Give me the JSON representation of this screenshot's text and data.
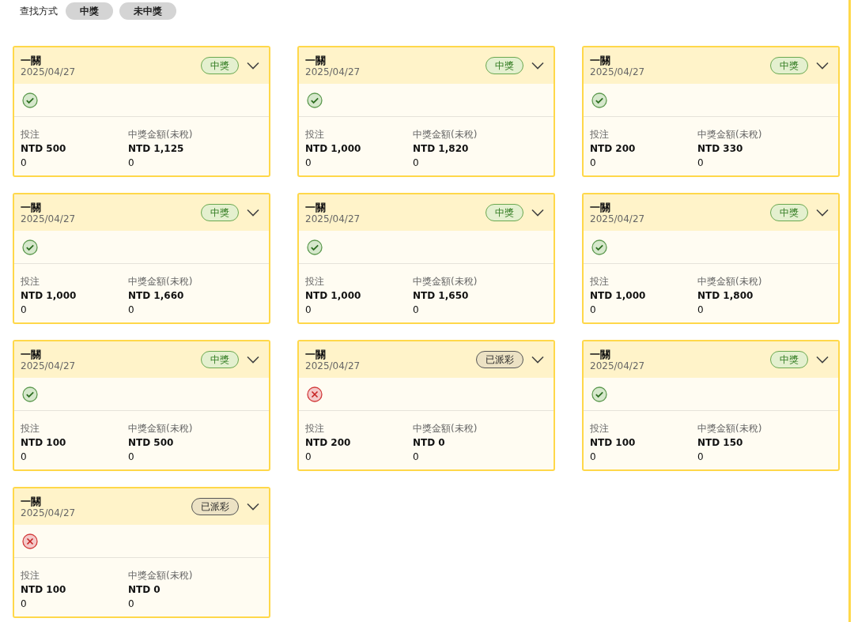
{
  "filter": {
    "label": "查找方式",
    "options": [
      "中獎",
      "未中獎"
    ]
  },
  "cards": [
    {
      "title": "一關",
      "date": "2025/04/27",
      "status": {
        "kind": "won",
        "label": "中獎"
      },
      "won": true,
      "stake_label": "投注",
      "stake": "NTD 500",
      "stake_extra": "0",
      "prize_label": "中獎金額(未稅)",
      "prize": "NTD 1,125",
      "prize_extra": "0"
    },
    {
      "title": "一關",
      "date": "2025/04/27",
      "status": {
        "kind": "won",
        "label": "中獎"
      },
      "won": true,
      "stake_label": "投注",
      "stake": "NTD 1,000",
      "stake_extra": "0",
      "prize_label": "中獎金額(未稅)",
      "prize": "NTD 1,820",
      "prize_extra": "0"
    },
    {
      "title": "一關",
      "date": "2025/04/27",
      "status": {
        "kind": "won",
        "label": "中獎"
      },
      "won": true,
      "stake_label": "投注",
      "stake": "NTD 200",
      "stake_extra": "0",
      "prize_label": "中獎金額(未稅)",
      "prize": "NTD 330",
      "prize_extra": "0"
    },
    {
      "title": "一關",
      "date": "2025/04/27",
      "status": {
        "kind": "won",
        "label": "中獎"
      },
      "won": true,
      "stake_label": "投注",
      "stake": "NTD 1,000",
      "stake_extra": "0",
      "prize_label": "中獎金額(未稅)",
      "prize": "NTD 1,660",
      "prize_extra": "0"
    },
    {
      "title": "一關",
      "date": "2025/04/27",
      "status": {
        "kind": "won",
        "label": "中獎"
      },
      "won": true,
      "stake_label": "投注",
      "stake": "NTD 1,000",
      "stake_extra": "0",
      "prize_label": "中獎金額(未稅)",
      "prize": "NTD 1,650",
      "prize_extra": "0"
    },
    {
      "title": "一關",
      "date": "2025/04/27",
      "status": {
        "kind": "won",
        "label": "中獎"
      },
      "won": true,
      "stake_label": "投注",
      "stake": "NTD 1,000",
      "stake_extra": "0",
      "prize_label": "中獎金額(未稅)",
      "prize": "NTD 1,800",
      "prize_extra": "0"
    },
    {
      "title": "一關",
      "date": "2025/04/27",
      "status": {
        "kind": "won",
        "label": "中獎"
      },
      "won": true,
      "stake_label": "投注",
      "stake": "NTD 100",
      "stake_extra": "0",
      "prize_label": "中獎金額(未稅)",
      "prize": "NTD 500",
      "prize_extra": "0"
    },
    {
      "title": "一關",
      "date": "2025/04/27",
      "status": {
        "kind": "paid",
        "label": "已派彩"
      },
      "won": false,
      "stake_label": "投注",
      "stake": "NTD 200",
      "stake_extra": "0",
      "prize_label": "中獎金額(未稅)",
      "prize": "NTD 0",
      "prize_extra": "0"
    },
    {
      "title": "一關",
      "date": "2025/04/27",
      "status": {
        "kind": "won",
        "label": "中獎"
      },
      "won": true,
      "stake_label": "投注",
      "stake": "NTD 100",
      "stake_extra": "0",
      "prize_label": "中獎金額(未稅)",
      "prize": "NTD 150",
      "prize_extra": "0"
    },
    {
      "title": "一關",
      "date": "2025/04/27",
      "status": {
        "kind": "paid",
        "label": "已派彩"
      },
      "won": false,
      "stake_label": "投注",
      "stake": "NTD 100",
      "stake_extra": "0",
      "prize_label": "中獎金額(未稅)",
      "prize": "NTD 0",
      "prize_extra": "0"
    }
  ]
}
